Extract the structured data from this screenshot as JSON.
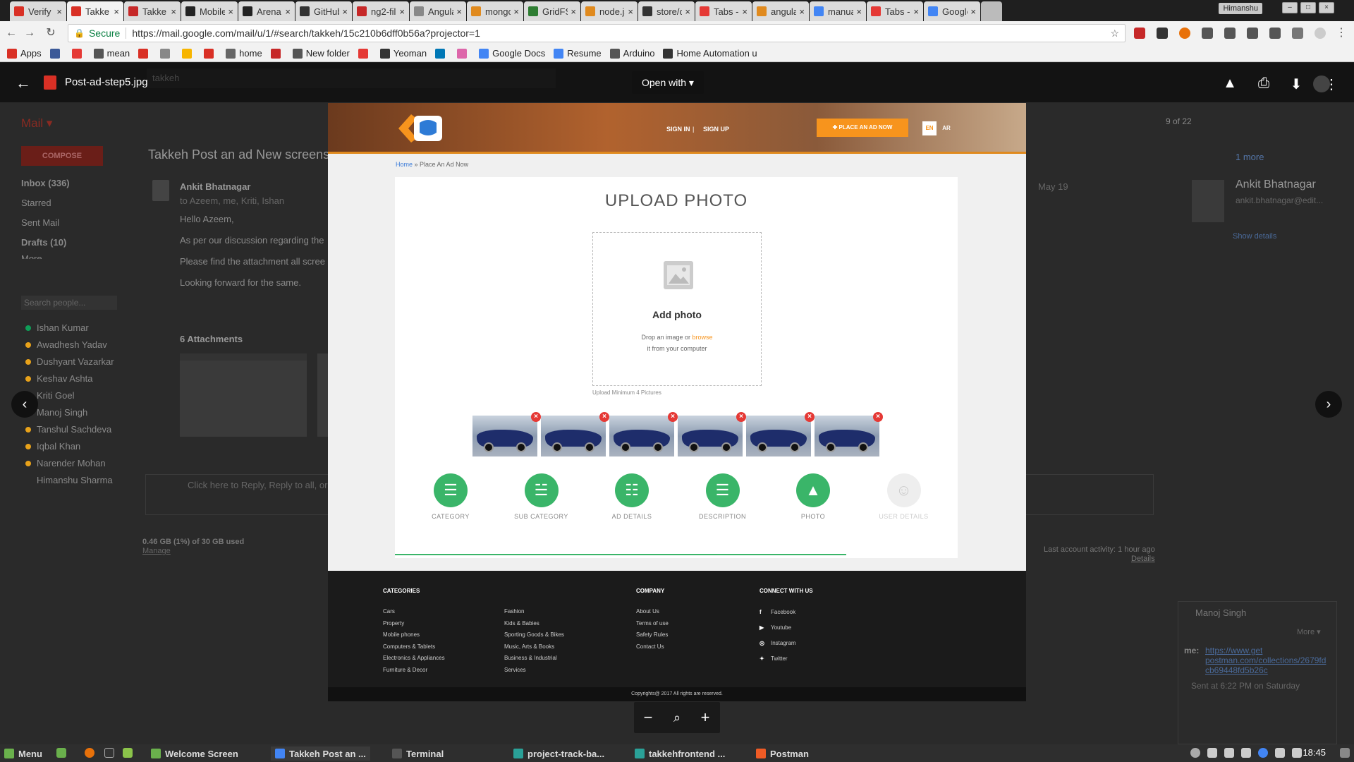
{
  "browser": {
    "tabs": [
      {
        "label": "Verify",
        "color": "#d93025"
      },
      {
        "label": "Takke",
        "color": "#d93025",
        "active": true
      },
      {
        "label": "Takke",
        "color": "#c62828"
      },
      {
        "label": "Mobile",
        "color": "#222"
      },
      {
        "label": "Arena",
        "color": "#222"
      },
      {
        "label": "GitHub",
        "color": "#333"
      },
      {
        "label": "ng2-fil",
        "color": "#c62828"
      },
      {
        "label": "Angula",
        "color": "#888"
      },
      {
        "label": "mongo",
        "color": "#e08a1e"
      },
      {
        "label": "GridFS",
        "color": "#2e7d32"
      },
      {
        "label": "node.js",
        "color": "#e08a1e"
      },
      {
        "label": "store/c",
        "color": "#333"
      },
      {
        "label": "Tabs -",
        "color": "#e53935"
      },
      {
        "label": "angula",
        "color": "#e08a1e"
      },
      {
        "label": "manua",
        "color": "#4285f4"
      },
      {
        "label": "Tabs -",
        "color": "#e53935"
      },
      {
        "label": "Google",
        "color": "#4285f4"
      }
    ],
    "user_label": "Himanshu",
    "secure_label": "Secure",
    "url": "https://mail.google.com/mail/u/1/#search/takkeh/15c210b6dff0b56a?projector=1",
    "bookmarks": [
      {
        "label": "Apps",
        "color": "#d93025"
      },
      {
        "label": "",
        "color": "#3b5998"
      },
      {
        "label": "",
        "color": "#e53935"
      },
      {
        "label": "mean",
        "color": "#555"
      },
      {
        "label": "",
        "color": "#d93025"
      },
      {
        "label": "",
        "color": "#888"
      },
      {
        "label": "",
        "color": "#f7b500"
      },
      {
        "label": "",
        "color": "#d93025"
      },
      {
        "label": "home",
        "color": "#666"
      },
      {
        "label": "",
        "color": "#c62828"
      },
      {
        "label": "New folder",
        "color": "#555"
      },
      {
        "label": "",
        "color": "#e53935"
      },
      {
        "label": "Yeoman",
        "color": "#333"
      },
      {
        "label": "",
        "color": "#0077b5"
      },
      {
        "label": "",
        "color": "#d6a"
      },
      {
        "label": "Google Docs",
        "color": "#4285f4"
      },
      {
        "label": "Resume",
        "color": "#4285f4"
      },
      {
        "label": "Arduino",
        "color": "#555"
      },
      {
        "label": "Home Automation u",
        "color": "#333"
      }
    ]
  },
  "gmail": {
    "search_value": "takkeh",
    "mail_label": "Mail ▾",
    "compose": "COMPOSE",
    "nav": [
      "Inbox (336)",
      "Starred",
      "Sent Mail",
      "Drafts (10)",
      "More"
    ],
    "search_people_placeholder": "Search people...",
    "contacts": [
      "Ishan Kumar",
      "Awadhesh Yadav",
      "Dushyant Vazarkar",
      "Keshav Ashta",
      "Kriti Goel",
      "Manoj Singh",
      "Tanshul Sachdeva",
      "Iqbal Khan",
      "Narender Mohan",
      "Himanshu Sharma"
    ],
    "subject": "Takkeh Post an ad New screens",
    "sender": "Ankit Bhatnagar",
    "to_line": "to Azeem, me, Kriti, Ishan",
    "body": [
      "Hello Azeem,",
      "As per our discussion regarding the",
      "Please find the attachment all scree",
      "Looking forward for the same."
    ],
    "attachments_label": "6 Attachments",
    "reply_hint": "Click here to Reply, Reply to all, or",
    "storage": "0.46 GB (1%) of 30 GB used",
    "manage": "Manage",
    "page_count": "9 of 22",
    "date": "May 19",
    "profile_name": "Ankit Bhatnagar",
    "profile_email": "ankit.bhatnagar@edit...",
    "show_details": "Show details",
    "more_people": "1 more",
    "last_activity": "Last account activity: 1 hour ago",
    "details": "Details",
    "chat_name": "Manoj Singh",
    "chat_more": "More ▾",
    "chat_me": "me:",
    "chat_link": "https://www.get postman.com/collections/2679fd cb69448fd5b26c",
    "chat_time": "Sent at 6:22 PM on Saturday"
  },
  "viewer": {
    "filename": "Post-ad-step5.jpg",
    "open_with": "Open with"
  },
  "site": {
    "sign_in": "SIGN IN",
    "divider": "|",
    "sign_up": "SIGN UP",
    "place_ad": "PLACE AN AD NOW",
    "lang_en": "EN",
    "lang_ar": "AR",
    "breadcrumb_home": "Home",
    "breadcrumb_sep": " » ",
    "breadcrumb_current": "Place An Ad Now",
    "upload_title": "UPLOAD PHOTO",
    "add_photo": "Add photo",
    "drop_text": "Drop an image or",
    "browse": "browse",
    "drop_text2": "it from your computer",
    "min_note": "Upload Minimum 4 Pictures",
    "photo_count": 6,
    "steps": [
      {
        "label": "CATEGORY",
        "icon": "list-icon",
        "done": true
      },
      {
        "label": "SUB CATEGORY",
        "icon": "sub-list-icon",
        "done": true
      },
      {
        "label": "AD DETAILS",
        "icon": "details-icon",
        "done": true
      },
      {
        "label": "DESCRIPTION",
        "icon": "description-icon",
        "done": true
      },
      {
        "label": "PHOTO",
        "icon": "photo-icon",
        "done": true
      },
      {
        "label": "USER DETAILS",
        "icon": "user-icon",
        "done": false
      }
    ],
    "footer": {
      "categories_h": "CATEGORIES",
      "col1": [
        "Cars",
        "Property",
        "Mobile phones",
        "Computers & Tablets",
        "Electronics & Appliances",
        "Furniture & Decor"
      ],
      "col2": [
        "Fashion",
        "Kids & Babies",
        "Sporting Goods & Bikes",
        "Music, Arts & Books",
        "Business & Industrial",
        "Services"
      ],
      "company_h": "COMPANY",
      "company": [
        "About Us",
        "Terms of use",
        "Safety Rules",
        "Contact Us"
      ],
      "connect_h": "CONNECT WITH US",
      "social": [
        "Facebook",
        "Youtube",
        "Instagram",
        "Twitter"
      ],
      "copyright": "Copyrights@ 2017 All rights are reserved."
    }
  },
  "taskbar": {
    "menu": "Menu",
    "items": [
      "Welcome Screen",
      "Takkeh Post an ...",
      "Terminal",
      "project-track-ba...",
      "takkehfrontend ...",
      "Postman"
    ],
    "clock": "18:45"
  },
  "colors": {
    "accent_orange": "#f7941d",
    "step_green": "#3ab569",
    "delete_red": "#e53935"
  }
}
